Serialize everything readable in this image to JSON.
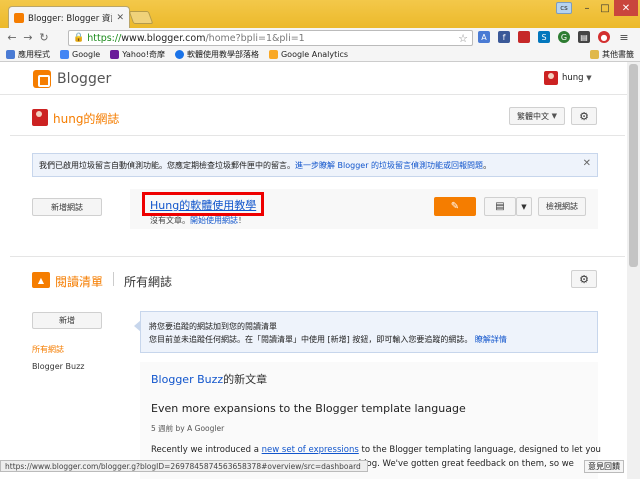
{
  "browser": {
    "tab_title": "Blogger: Blogger 資訊主",
    "url_secure": "https://",
    "url_host": "www.blogger.com",
    "url_path": "/home?bpli=1&pli=1",
    "user_chip": "cs",
    "status_url": "https://www.blogger.com/blogger.g?blogID=2697845874563658378#overview/src=dashboard"
  },
  "bookmarks": {
    "items": [
      {
        "label": "應用程式",
        "color": "#4a7bd4"
      },
      {
        "label": "Google",
        "color": "#4285f4"
      },
      {
        "label": "Yahoo!奇摩",
        "color": "#6a1b9a"
      },
      {
        "label": "軟體使用教學部落格",
        "color": "#1a73e8"
      },
      {
        "label": "Google Analytics",
        "color": "#f9a825"
      }
    ],
    "other": "其他書籤"
  },
  "header": {
    "brand": "Blogger",
    "user": "hung"
  },
  "dashboard": {
    "blog_title": "hung的網誌",
    "language": "繁體中文",
    "notice_text": "我們已啟用垃圾留言自動偵測功能。您應定期檢查垃圾郵件匣中的留言。",
    "notice_link": "進一步瞭解 Blogger 的垃圾留言偵測功能或回報問題",
    "notice_tail": "。",
    "new_blog_button": "新增網誌",
    "blog_link": "Hung的軟體使用教學",
    "no_posts": "沒有文章。",
    "start_link": "開始使用網誌",
    "start_tail": "！",
    "view_blog_button": "檢視網誌"
  },
  "reading": {
    "title": "閱讀清單",
    "subtitle": "所有網誌",
    "add_button": "新增",
    "nav_all": "所有網誌",
    "nav_buzz": "Blogger Buzz",
    "hint_line1": "將您要追蹤的網誌加到您的閱讀清單",
    "hint_line2": "您目前並未追蹤任何網誌。在「閱讀清單」中使用 [新增] 按鈕，即可輸入您要追蹤的網誌。",
    "hint_link": "瞭解詳情",
    "feed_source": "Blogger Buzz",
    "feed_source_suffix": "的新文章",
    "post_title": "Even more expansions to the Blogger template language",
    "post_meta": "5 週前 by A Googler",
    "post_text_1": "Recently we introduced a ",
    "post_link": "new set of expressions",
    "post_text_2": " to the Blogger templating language, designed to let you",
    "post_text_3": "our blog. We've gotten great feedback on them, so we"
  },
  "feedback": "意見回饋"
}
